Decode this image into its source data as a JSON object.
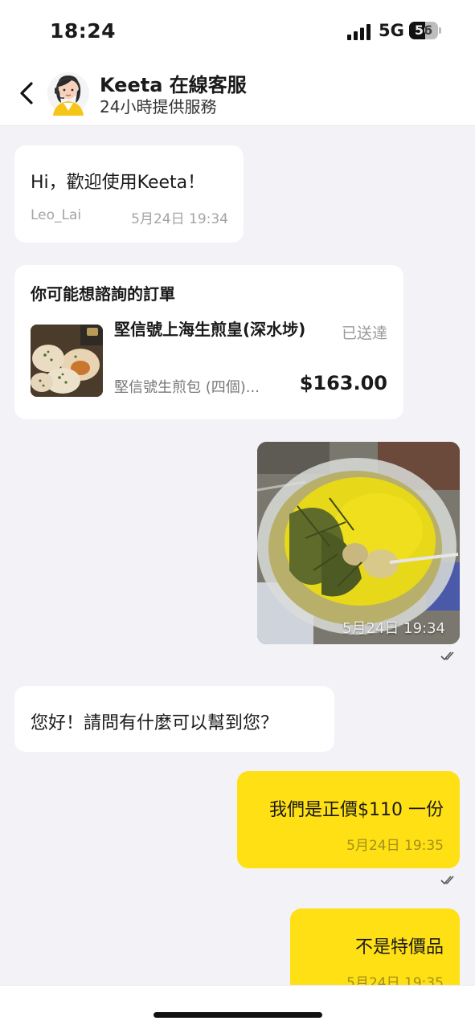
{
  "status_bar": {
    "time": "18:24",
    "network": "5G",
    "battery": "56",
    "battery_level": 0.56
  },
  "header": {
    "title": "Keeta 在線客服",
    "subtitle": "24小時提供服務",
    "back_icon": "chevron-left-icon",
    "avatar_icon": "agent-avatar-icon"
  },
  "messages": {
    "welcome": {
      "text": "Hi，歡迎使用Keeta！",
      "sender": "Leo_Lai",
      "time": "5月24日 19:34"
    },
    "order_card": {
      "title": "你可能想諮詢的訂單",
      "shop": "堅信號上海生煎皇(深水埗)",
      "status": "已送達",
      "item": "堅信號生煎包 (四個)...",
      "price": "$163.00"
    },
    "photo": {
      "time": "5月24日 19:34"
    },
    "greeting": {
      "text": "您好！請問有什麼可以幫到您？"
    },
    "sent_1": {
      "text": "我們是正價$110 一份",
      "time": "5月24日 19:35"
    },
    "sent_2": {
      "text": "不是特價品",
      "time": "5月24日 19:35"
    }
  },
  "colors": {
    "accent_yellow": "#ffe014",
    "background": "#f2f2f7"
  }
}
